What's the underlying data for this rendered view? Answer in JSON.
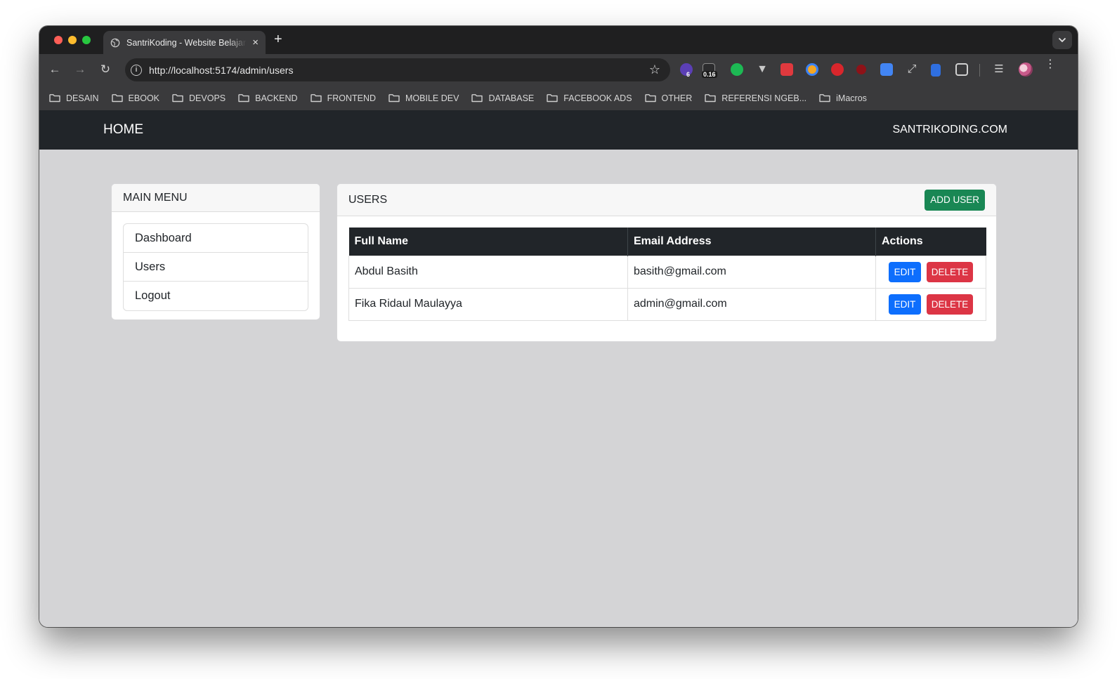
{
  "browser": {
    "tab_title": "SantriKoding - Website Belajar",
    "tab_close": "×",
    "new_tab": "+",
    "url": "http://localhost:5174/admin/users",
    "ext_badges": {
      "six": "6",
      "timer": "0.16"
    },
    "bookmarks": [
      "DESAIN",
      "EBOOK",
      "DEVOPS",
      "BACKEND",
      "FRONTEND",
      "MOBILE DEV",
      "DATABASE",
      "FACEBOOK ADS",
      "OTHER",
      "REFERENSI NGEB...",
      "iMacros"
    ]
  },
  "navbar": {
    "home": "HOME",
    "site": "SANTRIKODING.COM"
  },
  "menu": {
    "title": "MAIN MENU",
    "items": [
      "Dashboard",
      "Users",
      "Logout"
    ]
  },
  "users": {
    "title": "USERS",
    "add_label": "ADD USER",
    "columns": [
      "Full Name",
      "Email Address",
      "Actions"
    ],
    "rows": [
      {
        "name": "Abdul Basith",
        "email": "basith@gmail.com",
        "edit": "EDIT",
        "delete": "DELETE"
      },
      {
        "name": "Fika Ridaul Maulayya",
        "email": "admin@gmail.com",
        "edit": "EDIT",
        "delete": "DELETE"
      }
    ]
  },
  "colors": {
    "navbar": "#212529",
    "page_bg": "#d4d4d6",
    "success": "#198754",
    "primary": "#0d6efd",
    "danger": "#dc3545"
  }
}
